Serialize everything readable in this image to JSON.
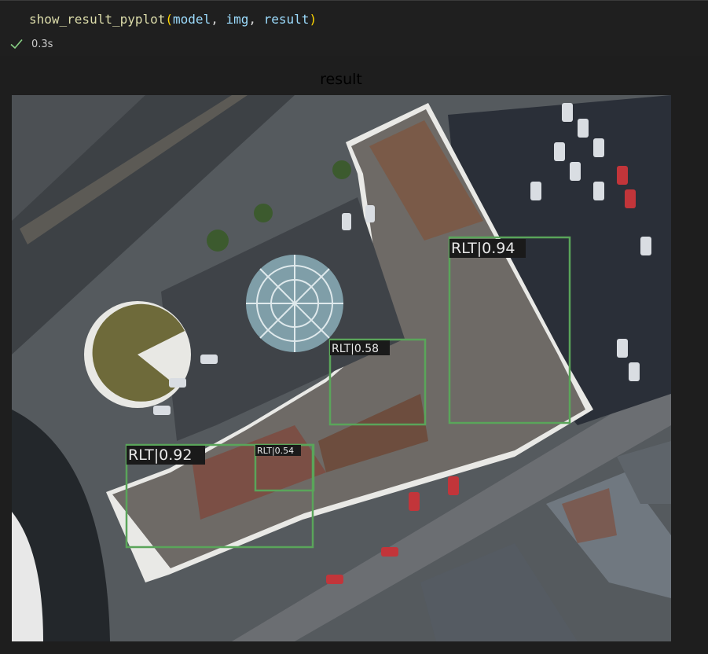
{
  "cell": {
    "code": {
      "function": "show_result_pyplot",
      "args": [
        "model",
        "img",
        "result"
      ]
    },
    "status": {
      "icon": "checkmark-icon",
      "exec_time": "0.3s",
      "color": "#89d185"
    }
  },
  "output": {
    "plot_title": "result",
    "detections": [
      {
        "label": "RLT|0.94",
        "class": "RLT",
        "score": 0.94
      },
      {
        "label": "RLT|0.58",
        "class": "RLT",
        "score": 0.58
      },
      {
        "label": "RLT|0.92",
        "class": "RLT",
        "score": 0.92
      },
      {
        "label": "RLT|0.54",
        "class": "RLT",
        "score": 0.54
      }
    ],
    "box_color": "#5aa55a"
  }
}
